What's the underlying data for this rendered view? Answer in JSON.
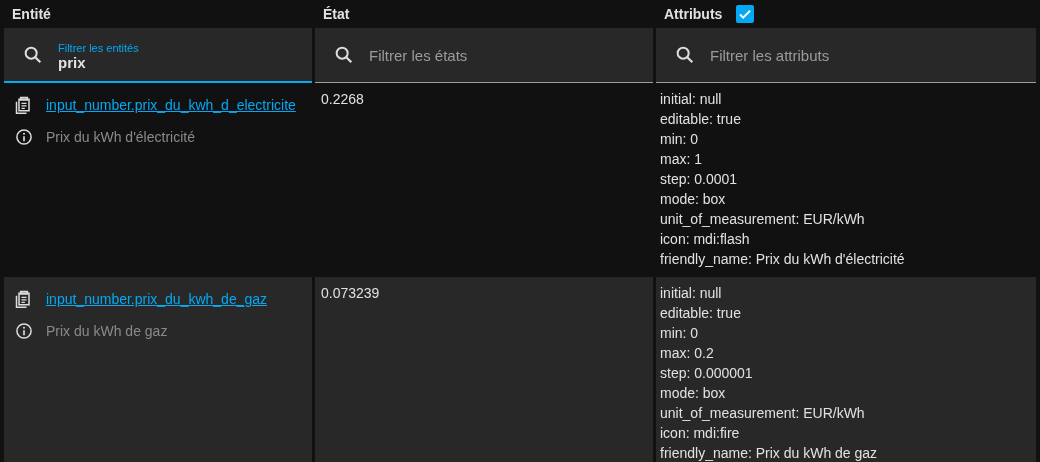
{
  "columns": [
    {
      "label": "Entité"
    },
    {
      "label": "État"
    },
    {
      "label": "Attributs",
      "checkbox": {
        "checked": true
      }
    }
  ],
  "filters": [
    {
      "label": "Filtrer les entités",
      "value": "prix",
      "focused": true
    },
    {
      "placeholder": "Filtrer les états",
      "focused": false
    },
    {
      "placeholder": "Filtrer les attributs",
      "focused": false
    }
  ],
  "rows": [
    {
      "entity_id": "input_number.prix_du_kwh_d_electricite",
      "friendly_name": "Prix du kWh d'électricité",
      "state": "0.2268",
      "attributes": [
        "initial: null",
        "editable: true",
        "min: 0",
        "max: 1",
        "step: 0.0001",
        "mode: box",
        "unit_of_measurement: EUR/kWh",
        "icon: mdi:flash",
        "friendly_name: Prix du kWh d'électricité"
      ]
    },
    {
      "entity_id": "input_number.prix_du_kwh_de_gaz",
      "friendly_name": "Prix du kWh de gaz",
      "state": "0.073239",
      "attributes": [
        "initial: null",
        "editable: true",
        "min: 0",
        "max: 0.2",
        "step: 0.000001",
        "mode: box",
        "unit_of_measurement: EUR/kWh",
        "icon: mdi:fire",
        "friendly_name: Prix du kWh de gaz"
      ]
    }
  ]
}
